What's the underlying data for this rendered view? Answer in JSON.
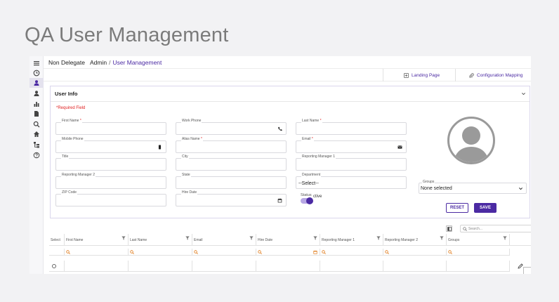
{
  "page_title": "QA User Management",
  "header": {
    "delegate": "Non Delegate",
    "breadcrumb_root": "Admin",
    "breadcrumb_sep": "/",
    "breadcrumb_current": "User Management"
  },
  "tabs": [
    {
      "label": "Landing Page",
      "icon": "home-box-icon"
    },
    {
      "label": "Configuration Mapping",
      "icon": "paperclip-icon"
    }
  ],
  "card": {
    "title": "User Info",
    "required_note": "*Required Field"
  },
  "fields": {
    "first_name": {
      "label": "First Name",
      "required": "*"
    },
    "work_phone": {
      "label": "Work Phone"
    },
    "last_name": {
      "label": "Last Name",
      "required": "*"
    },
    "mobile_phone": {
      "label": "Mobile Phone"
    },
    "alias_name": {
      "label": "Alias Name",
      "required": "*"
    },
    "email": {
      "label": "Email",
      "required": "*"
    },
    "title": {
      "label": "Title"
    },
    "city": {
      "label": "City"
    },
    "reporting_manager_1": {
      "label": "Reporting Manager 1"
    },
    "reporting_manager_2": {
      "label": "Reporting Manager 2"
    },
    "state": {
      "label": "State"
    },
    "department": {
      "label": "Department",
      "value": "--Select--"
    },
    "zip_code": {
      "label": "ZIP Code"
    },
    "hire_date": {
      "label": "Hire Date"
    }
  },
  "groups": {
    "label": "Groups",
    "value": "None selected"
  },
  "status": {
    "label": "Status",
    "text": "ctive",
    "on": true
  },
  "buttons": {
    "reset": "RESET",
    "save": "SAVE"
  },
  "grid": {
    "search_placeholder": "Search...",
    "columns": [
      "Select",
      "First Name",
      "Last Name",
      "Email",
      "Hire Date",
      "Reporting Manager 1",
      "Reporting Manager 2",
      "Groups"
    ]
  },
  "colors": {
    "accent": "#4b2aa3",
    "required": "#e02020",
    "filter_icon": "#e07b1a"
  }
}
